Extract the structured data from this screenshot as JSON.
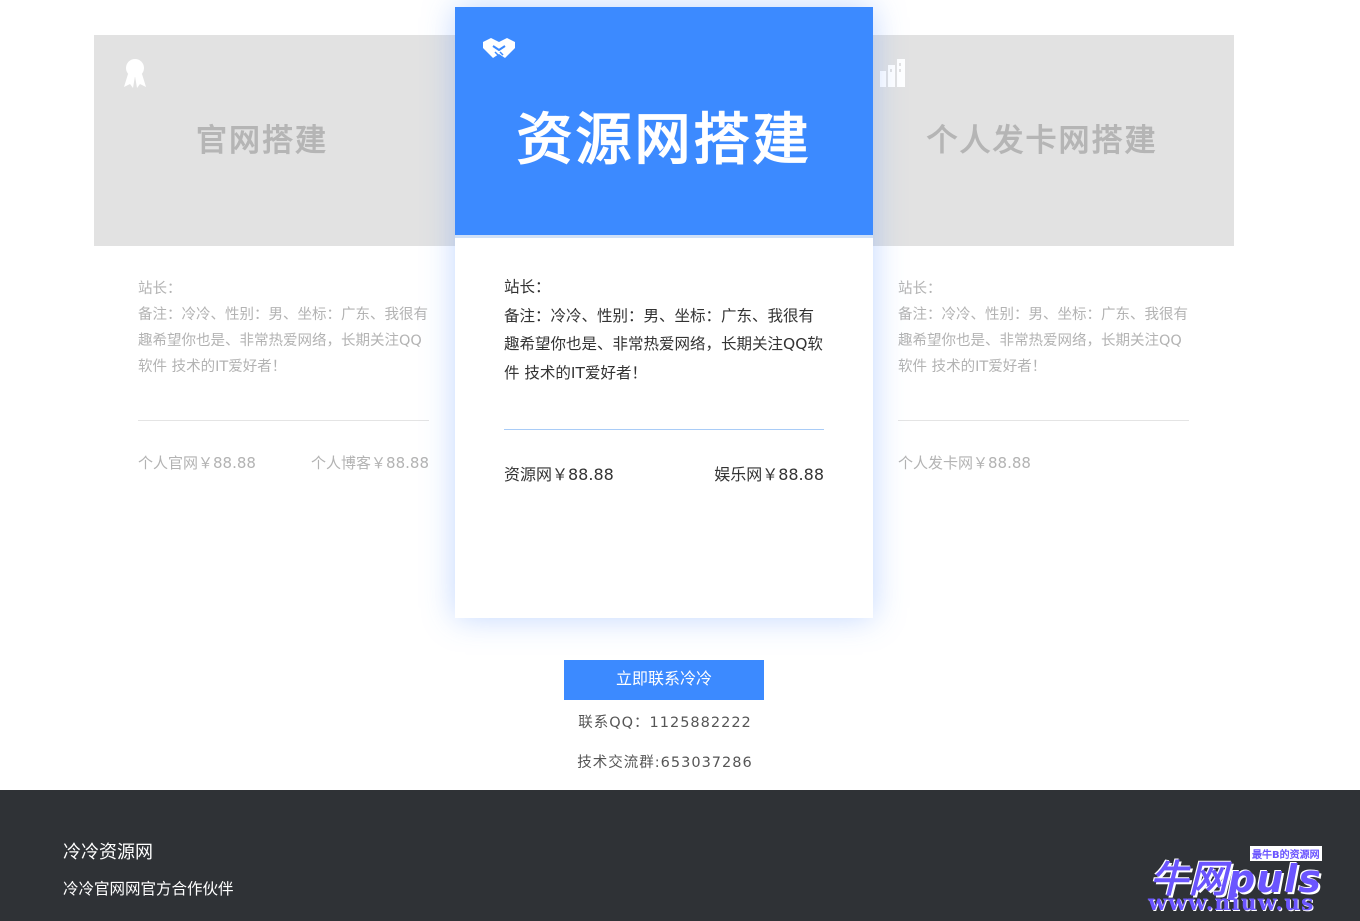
{
  "cards": {
    "left": {
      "title": "官网搭建",
      "icon": "award-ribbon-icon",
      "owner_label": "站长：",
      "description": "备注：冷冷、性别：男、坐标：广东、我很有趣希望你也是、非常热爱网络，长期关注QQ软件 技术的IT爱好者！",
      "price_1": "个人官网￥88.88",
      "price_2": "个人博客￥88.88"
    },
    "center": {
      "title": "资源网搭建",
      "icon": "handshake-icon",
      "owner_label": "站长：",
      "description": "备注：冷冷、性别：男、坐标：广东、我很有趣希望你也是、非常热爱网络，长期关注QQ软件 技术的IT爱好者！",
      "price_1": "资源网￥88.88",
      "price_2": "娱乐网￥88.88"
    },
    "right": {
      "title": "个人发卡网搭建",
      "icon": "buildings-icon",
      "owner_label": "站长：",
      "description": "备注：冷冷、性别：男、坐标：广东、我很有趣希望你也是、非常热爱网络，长期关注QQ软件 技术的IT爱好者！",
      "price_1": "个人发卡网￥88.88"
    }
  },
  "contact": {
    "button_label": "立即联系冷冷",
    "qq": "联系QQ：1125882222",
    "group": "技术交流群:653037286"
  },
  "footer": {
    "brand": "冷冷资源网",
    "subtitle": "冷冷官网网官方合作伙伴"
  },
  "watermark": {
    "main": "牛网puls",
    "tag": "最牛B的资源网",
    "url": "www.niuw.us"
  },
  "colors": {
    "accent": "#3c8aff",
    "footer_bg": "#2f3236",
    "side_head_bg": "#e2e2e2"
  }
}
